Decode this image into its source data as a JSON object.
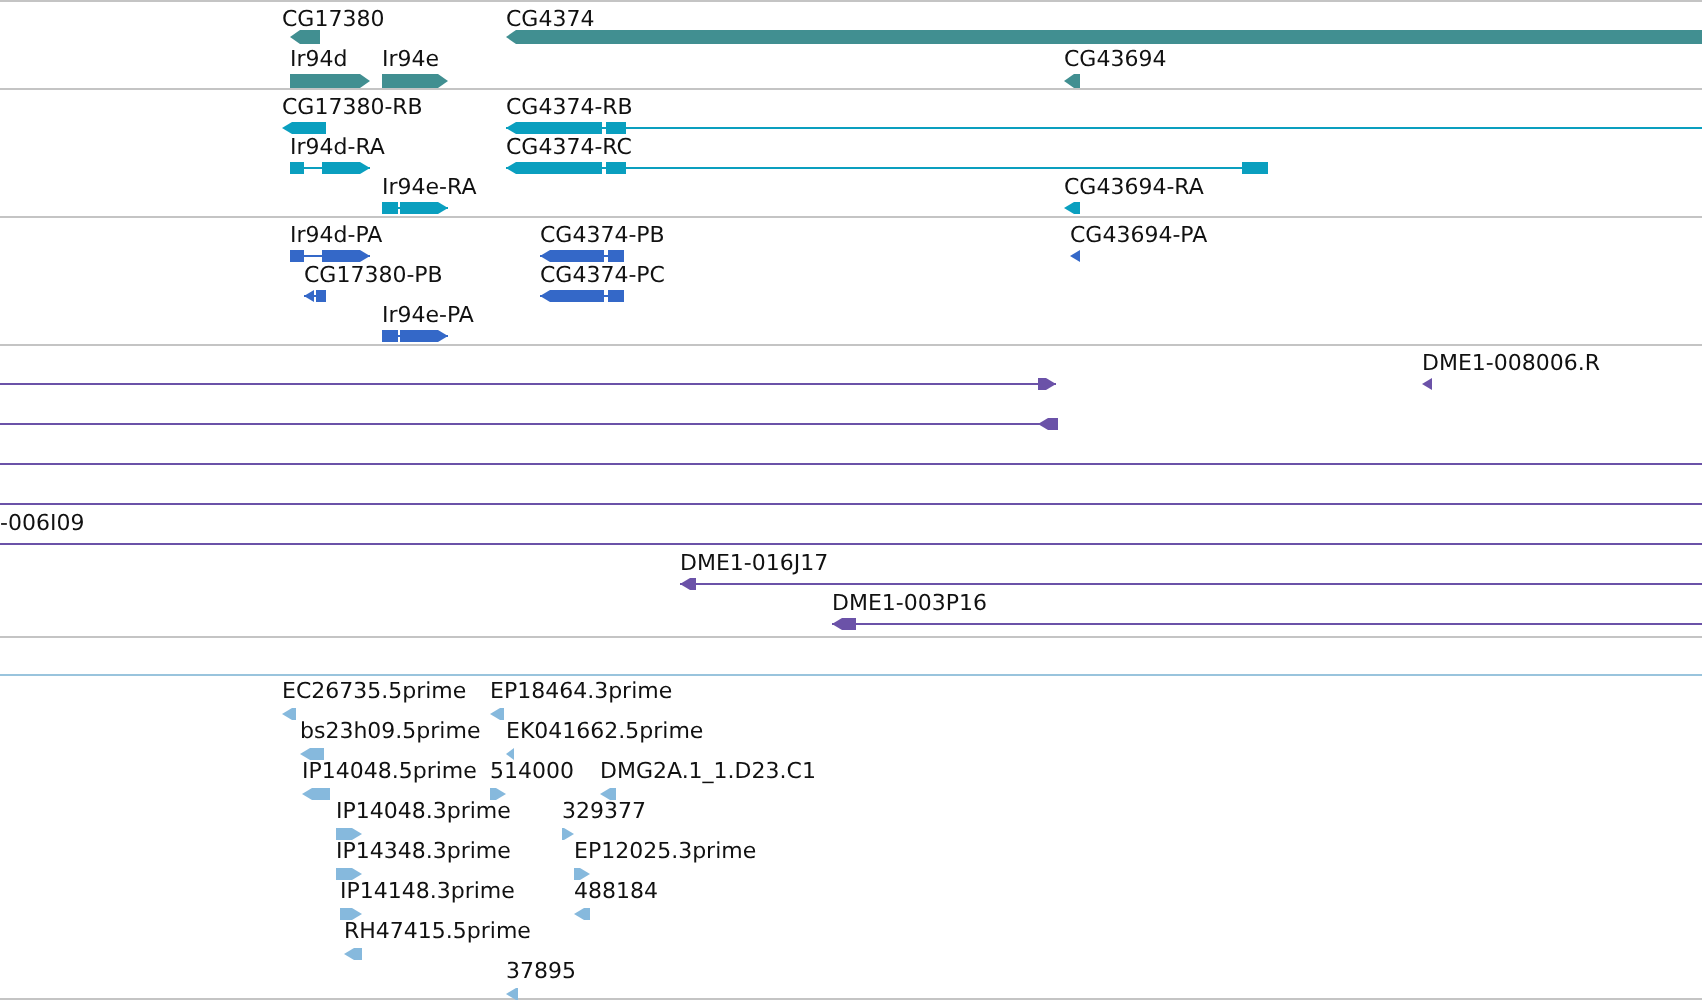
{
  "tracks": [
    {
      "kind": "gene",
      "features": [
        {
          "label": "CG17380",
          "reverse": true
        },
        {
          "label": "CG4374",
          "reverse": true
        },
        {
          "label": "Ir94d",
          "reverse": false
        },
        {
          "label": "Ir94e",
          "reverse": false
        },
        {
          "label": "CG43694",
          "reverse": true
        }
      ]
    },
    {
      "kind": "transcript",
      "features": [
        {
          "label": "CG17380-RB",
          "reverse": true
        },
        {
          "label": "CG4374-RB",
          "reverse": true
        },
        {
          "label": "Ir94d-RA",
          "reverse": false
        },
        {
          "label": "CG4374-RC",
          "reverse": true
        },
        {
          "label": "Ir94e-RA",
          "reverse": false
        },
        {
          "label": "CG43694-RA",
          "reverse": true
        }
      ]
    },
    {
      "kind": "protein",
      "features": [
        {
          "label": "Ir94d-PA",
          "reverse": false
        },
        {
          "label": "CG4374-PB",
          "reverse": true
        },
        {
          "label": "CG43694-PA",
          "reverse": true
        },
        {
          "label": "CG17380-PB",
          "reverse": true
        },
        {
          "label": "CG4374-PC",
          "reverse": true
        },
        {
          "label": "Ir94e-PA",
          "reverse": false
        }
      ]
    },
    {
      "kind": "clone",
      "features": [
        {
          "kind": "arrow",
          "label": "DME1-008006.R",
          "reverse": true
        },
        {
          "kind": "arrow",
          "reverse": false
        },
        {
          "kind": "arrow",
          "reverse": true
        },
        {
          "kind": "line"
        },
        {
          "kind": "line"
        },
        {
          "kind": "line",
          "label": "-006I09"
        },
        {
          "kind": "arrow",
          "label": "DME1-016J17",
          "reverse": true
        },
        {
          "kind": "arrow",
          "label": "DME1-003P16",
          "reverse": true
        }
      ]
    },
    {
      "kind": "est",
      "features": [
        {
          "label": "EC26735.5prime",
          "reverse": true
        },
        {
          "label": "EP18464.3prime",
          "reverse": true
        },
        {
          "label": "bs23h09.5prime",
          "reverse": true
        },
        {
          "label": "EK041662.5prime",
          "reverse": true
        },
        {
          "label": "IP14048.5prime",
          "reverse": true
        },
        {
          "label": "514000",
          "reverse": false
        },
        {
          "label": "DMG2A.1_1.D23.C1",
          "reverse": true
        },
        {
          "label": "IP14048.3prime",
          "reverse": false
        },
        {
          "label": "329377",
          "reverse": false
        },
        {
          "label": "IP14348.3prime",
          "reverse": false
        },
        {
          "label": "EP12025.3prime",
          "reverse": false
        },
        {
          "label": "IP14148.3prime",
          "reverse": false
        },
        {
          "label": "488184",
          "reverse": true
        },
        {
          "label": "RH47415.5prime",
          "reverse": true
        },
        {
          "label": "37895",
          "reverse": true
        }
      ]
    }
  ]
}
